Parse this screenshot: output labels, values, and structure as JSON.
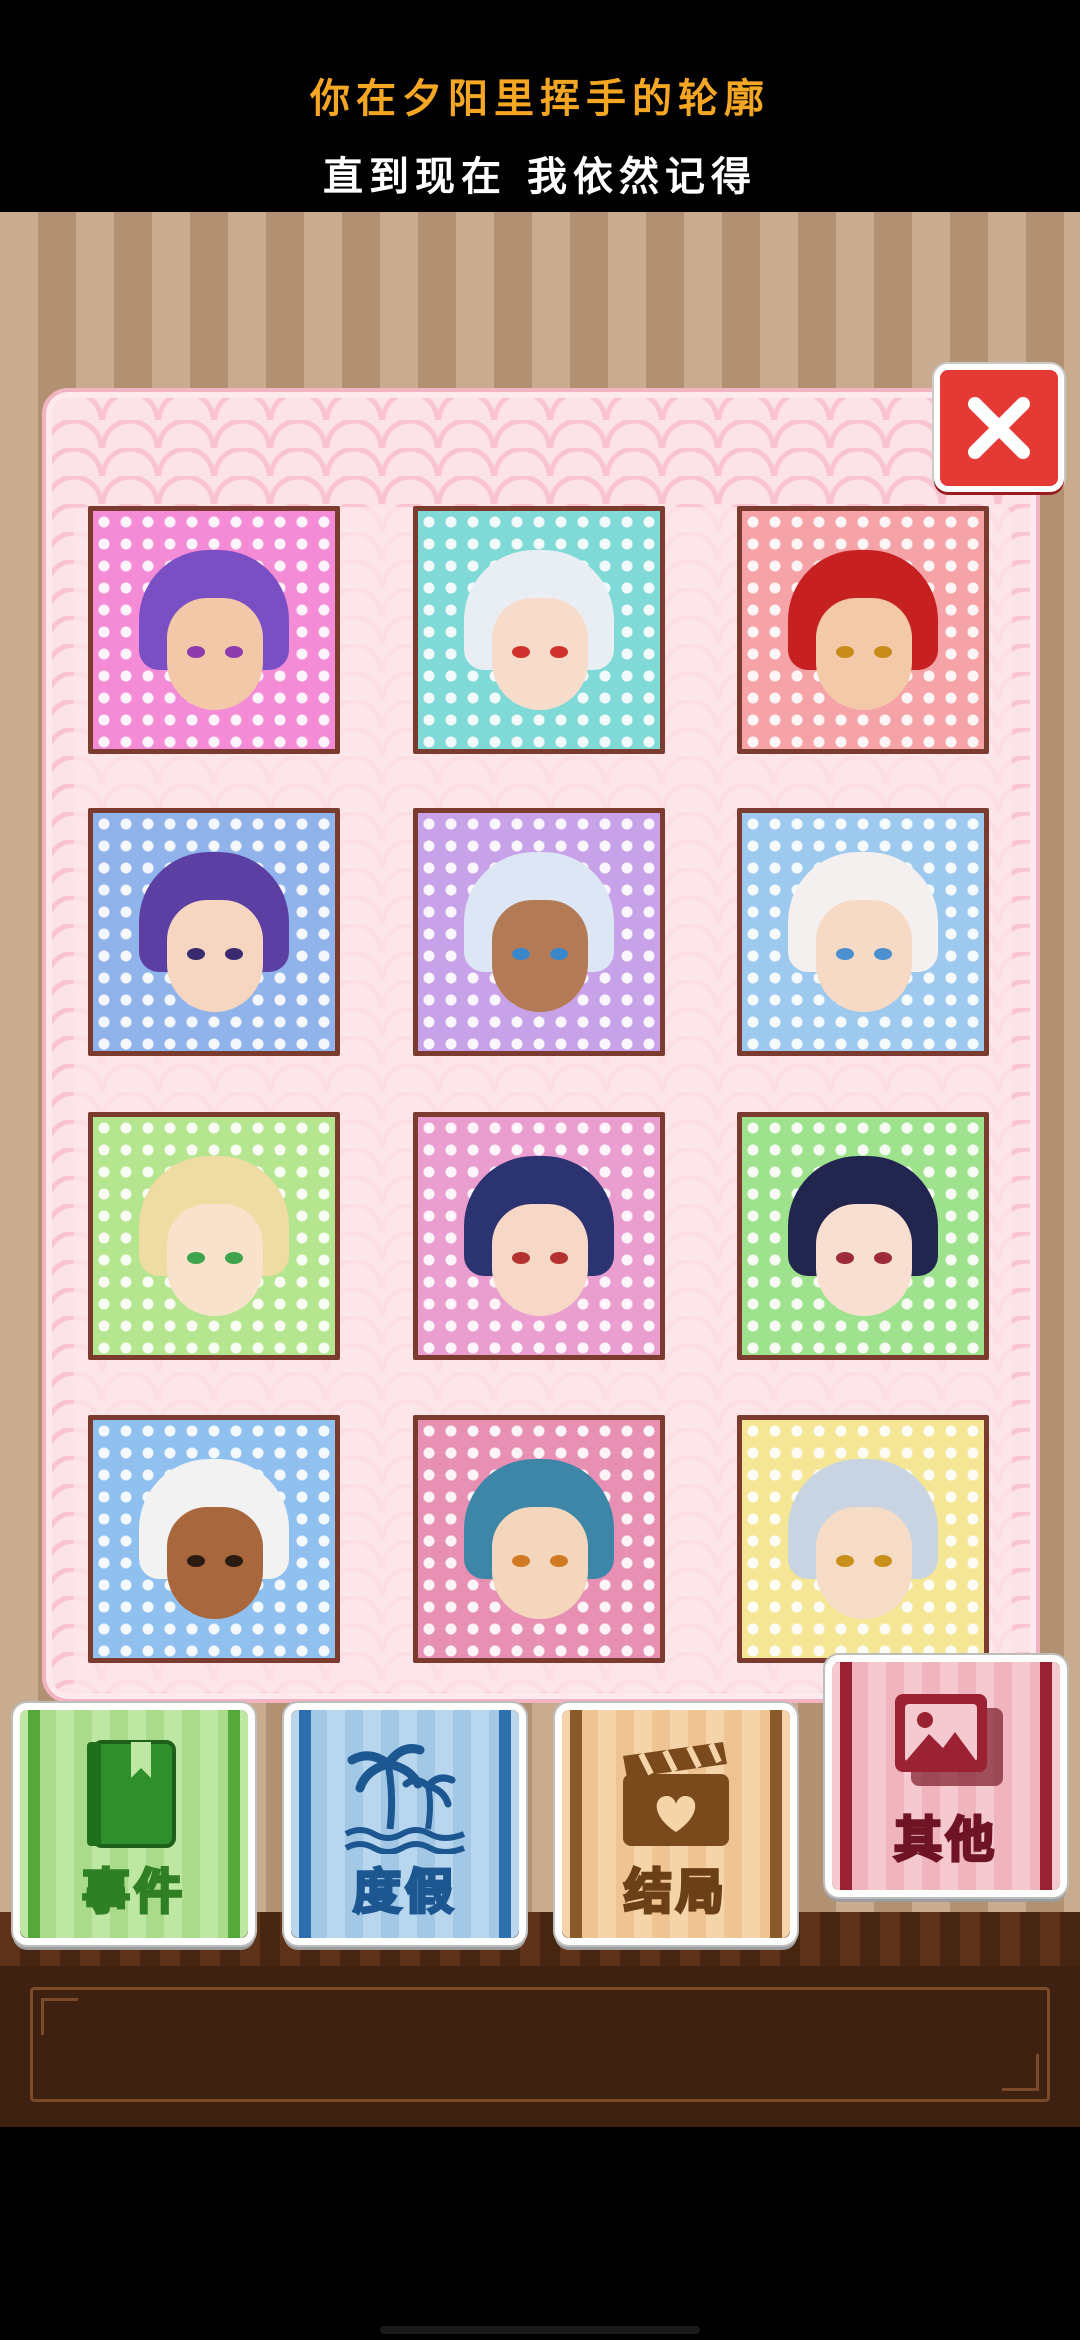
{
  "lyrics": {
    "line1": "你在夕阳里挥手的轮廓",
    "line2": "直到现在 我依然记得"
  },
  "gallery": {
    "close_icon": "close-icon",
    "portraits": [
      {
        "hair": "#7b4fc4",
        "bg": "#f38bd6",
        "skin": "#f3c8a9",
        "eyes": "#8e3bb0"
      },
      {
        "hair": "#e8eef3",
        "bg": "#7fd9d6",
        "skin": "#f7dccb",
        "eyes": "#d0312d"
      },
      {
        "hair": "#c62020",
        "bg": "#f5a3a7",
        "skin": "#f4c9a8",
        "eyes": "#c98b1a"
      },
      {
        "hair": "#5b3fa3",
        "bg": "#8fb3ea",
        "skin": "#f6d6c0",
        "eyes": "#3a2a70"
      },
      {
        "hair": "#dde6f5",
        "bg": "#c8a2e8",
        "skin": "#b47a55",
        "eyes": "#3c87c9"
      },
      {
        "hair": "#f5f0f0",
        "bg": "#9ec9ef",
        "skin": "#f6dac6",
        "eyes": "#4b8fd1"
      },
      {
        "hair": "#efdca2",
        "bg": "#b5e58f",
        "skin": "#f8e2cb",
        "eyes": "#3ea34b"
      },
      {
        "hair": "#2b3370",
        "bg": "#ea9dcf",
        "skin": "#f7d7c6",
        "eyes": "#b3312f"
      },
      {
        "hair": "#22264f",
        "bg": "#9fe28d",
        "skin": "#f8dfd1",
        "eyes": "#9e2b3c"
      },
      {
        "hair": "#f2f2f2",
        "bg": "#8fc0ef",
        "skin": "#a8673d",
        "eyes": "#2a1a10"
      },
      {
        "hair": "#3e86a8",
        "bg": "#e88fb4",
        "skin": "#f4d6bd",
        "eyes": "#d07a22"
      },
      {
        "hair": "#c9d4e3",
        "bg": "#f4e694",
        "skin": "#f6dcc6",
        "eyes": "#c9901c"
      }
    ]
  },
  "categories": {
    "events": {
      "label": "事件",
      "icon": "book-bookmark-icon"
    },
    "vacation": {
      "label": "度假",
      "icon": "palm-tree-icon"
    },
    "endings": {
      "label": "结局",
      "icon": "clapperboard-heart-icon"
    },
    "other": {
      "label": "其他",
      "icon": "picture-gallery-icon"
    }
  }
}
